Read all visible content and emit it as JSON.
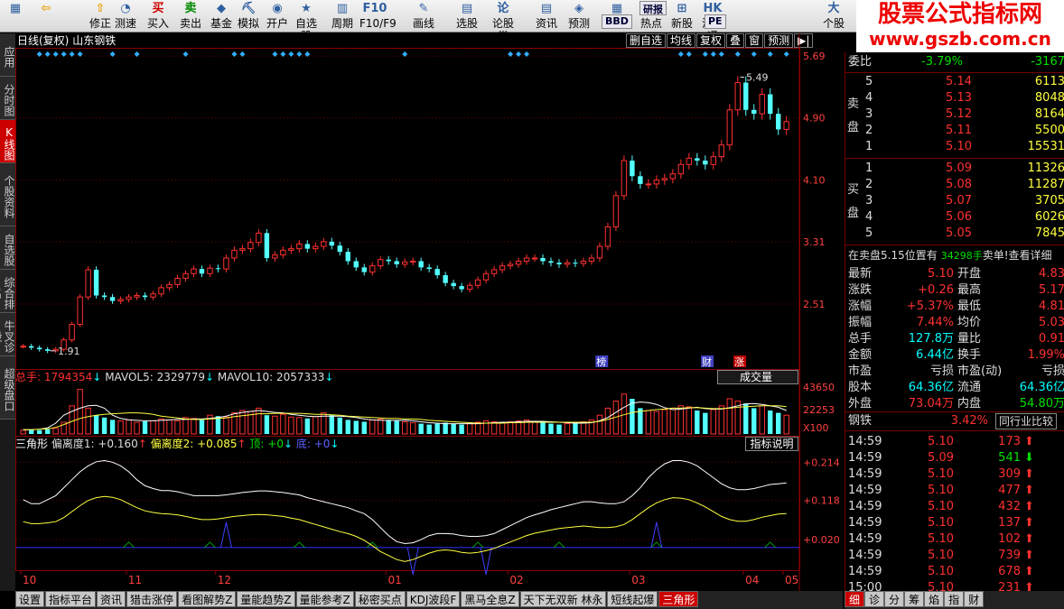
{
  "toolbar": {
    "buttons": [
      {
        "label": "",
        "icon": "app-icon"
      },
      {
        "label": "",
        "icon": "back-icon"
      },
      {
        "label": "修正",
        "icon": "up-down-icon"
      },
      {
        "label": "测速",
        "icon": "clock-icon"
      },
      {
        "label": "买入",
        "icon": "buy-icon",
        "glyph": "买"
      },
      {
        "label": "卖出",
        "icon": "sell-icon",
        "glyph": "卖"
      },
      {
        "label": "基金",
        "icon": "fund-icon"
      },
      {
        "label": "模拟",
        "icon": "simulate-icon"
      },
      {
        "label": "开户",
        "icon": "account-icon"
      },
      {
        "label": "自选股",
        "icon": "star-icon"
      },
      {
        "label": "周期",
        "icon": "period-icon"
      },
      {
        "label": "F10/F9",
        "icon": "f10-icon"
      },
      {
        "label": "画线",
        "icon": "draw-icon"
      },
      {
        "label": "选股",
        "icon": "select-icon"
      },
      {
        "label": "论股堂",
        "icon": "forum-icon"
      },
      {
        "label": "资讯",
        "icon": "news-icon"
      },
      {
        "label": "预测",
        "icon": "forecast-icon"
      },
      {
        "label": "数据",
        "icon": "data-icon"
      },
      {
        "label": "热点",
        "icon": "hot-icon"
      },
      {
        "label": "新股",
        "icon": "new-stock-icon"
      },
      {
        "label": "沪港通",
        "icon": "hk-icon"
      },
      {
        "label": "个股",
        "icon": "stock-icon"
      }
    ],
    "small_buttons": [
      "BBD",
      "PE",
      "研报"
    ]
  },
  "watermark": {
    "line1": "股票公式指标网",
    "line2": "www.gszb.com.cn"
  },
  "left_tabs": [
    {
      "label": "应用"
    },
    {
      "label": "分时图"
    },
    {
      "label": "K线图",
      "active": true
    },
    {
      "label": "个股资料"
    },
    {
      "label": "自选股"
    },
    {
      "label": "综合排名"
    },
    {
      "label": "牛叉诊股"
    },
    {
      "label": "超级盘口"
    }
  ],
  "chart_header": {
    "period": "日线(复权)",
    "stock_name": "山东钢铁",
    "buttons": [
      "删自选",
      "均线",
      "复权",
      "叠",
      "窗",
      "预测",
      "▶|"
    ]
  },
  "chart_data": [
    {
      "type": "candlestick",
      "title": "日线(复权) 山东钢铁",
      "y_ticks": [
        5.69,
        4.9,
        4.1,
        3.31,
        2.51
      ],
      "ylim": [
        1.7,
        5.75
      ],
      "x_ticks": [
        "10",
        "11",
        "12",
        "01",
        "02",
        "03",
        "04",
        "05"
      ],
      "annotations": {
        "high": "5.49",
        "low": "1.91",
        "markers": [
          "榜",
          "财",
          "涨"
        ]
      },
      "close": [
        1.97,
        1.95,
        1.93,
        1.91,
        1.93,
        2.05,
        2.25,
        2.6,
        2.95,
        2.62,
        2.6,
        2.55,
        2.57,
        2.6,
        2.62,
        2.6,
        2.64,
        2.72,
        2.76,
        2.84,
        2.9,
        2.96,
        2.9,
        2.97,
        2.96,
        3.1,
        3.2,
        3.22,
        3.3,
        3.42,
        3.1,
        3.14,
        3.2,
        3.22,
        3.28,
        3.22,
        3.25,
        3.31,
        3.26,
        3.18,
        3.06,
        2.98,
        2.92,
        3.0,
        3.08,
        3.06,
        3.02,
        3.05,
        3.06,
        2.98,
        2.96,
        2.88,
        2.78,
        2.74,
        2.7,
        2.75,
        2.82,
        2.9,
        2.95,
        3.0,
        3.02,
        3.06,
        3.1,
        3.1,
        3.06,
        3.04,
        3.02,
        3.04,
        3.03,
        3.06,
        3.1,
        3.25,
        3.5,
        3.9,
        4.35,
        4.15,
        4.05,
        4.05,
        4.1,
        4.12,
        4.18,
        4.3,
        4.38,
        4.35,
        4.3,
        4.4,
        4.55,
        5.0,
        5.35,
        5.0,
        4.95,
        5.2,
        4.95,
        4.75,
        4.85
      ]
    },
    {
      "type": "bar",
      "title": "成交量",
      "legend": {
        "total": "总手: 1794354",
        "mavol5": "MAVOL5: 2329779",
        "mavol10": "MAVOL10: 2057333"
      },
      "y_ticks": [
        "43650",
        "22253",
        "X100"
      ],
      "volume": [
        8,
        9,
        8,
        10,
        12,
        25,
        60,
        95,
        55,
        40,
        35,
        30,
        28,
        30,
        25,
        27,
        28,
        32,
        30,
        28,
        35,
        33,
        30,
        40,
        38,
        36,
        45,
        50,
        48,
        55,
        40,
        38,
        42,
        36,
        35,
        33,
        37,
        45,
        40,
        35,
        30,
        28,
        26,
        30,
        32,
        30,
        28,
        26,
        24,
        22,
        20,
        22,
        24,
        22,
        20,
        22,
        25,
        28,
        26,
        24,
        26,
        28,
        30,
        26,
        24,
        22,
        20,
        22,
        24,
        26,
        30,
        40,
        55,
        70,
        85,
        75,
        55,
        50,
        48,
        52,
        55,
        60,
        58,
        50,
        45,
        52,
        60,
        75,
        70,
        65,
        55,
        60,
        50,
        45,
        40
      ],
      "mavol5": [
        9,
        9,
        10,
        13,
        23,
        40,
        48,
        55,
        60,
        61,
        55,
        40,
        33,
        30,
        29,
        28,
        28,
        29,
        30,
        31,
        31,
        32,
        32,
        33,
        35,
        38,
        43,
        46,
        48,
        50,
        48,
        46,
        45,
        42,
        40,
        38,
        37,
        38,
        38,
        38,
        37,
        35,
        32,
        30,
        29,
        29,
        29,
        29,
        28,
        26,
        24,
        23,
        22,
        22,
        22,
        22,
        22,
        23,
        24,
        25,
        25,
        26,
        27,
        27,
        27,
        26,
        25,
        24,
        23,
        23,
        24,
        28,
        35,
        46,
        57,
        66,
        68,
        67,
        63,
        56,
        52,
        53,
        55,
        57,
        54,
        53,
        53,
        56,
        60,
        64,
        65,
        63,
        60,
        57,
        50
      ],
      "mavol10": [
        9,
        9,
        10,
        11,
        14,
        20,
        27,
        33,
        37,
        40,
        42,
        43,
        44,
        45,
        45,
        44,
        42,
        38,
        36,
        34,
        32,
        31,
        31,
        32,
        33,
        34,
        37,
        39,
        41,
        43,
        43,
        44,
        44,
        44,
        44,
        43,
        42,
        42,
        41,
        40,
        38,
        37,
        36,
        35,
        34,
        33,
        33,
        32,
        32,
        31,
        29,
        28,
        27,
        26,
        25,
        24,
        23,
        23,
        23,
        23,
        24,
        24,
        25,
        25,
        25,
        25,
        25,
        25,
        25,
        25,
        25,
        27,
        31,
        36,
        41,
        46,
        48,
        50,
        52,
        53,
        55,
        55,
        56,
        56,
        55,
        54,
        54,
        55,
        57,
        58,
        59,
        60,
        60,
        60,
        58
      ]
    },
    {
      "type": "line",
      "title": "三角形",
      "legend": {
        "name": "三角形",
        "dev1": "偏离度1: +0.160",
        "dev2": "偏离度2: +0.085",
        "top": "顶: +0",
        "bottom": "底: +0"
      },
      "y_ticks": [
        "+0.214",
        "+0.118",
        "+0.020"
      ],
      "ylim": [
        -0.05,
        0.235
      ],
      "series": [
        {
          "name": "偏离度1",
          "values": [
            0.12,
            0.11,
            0.11,
            0.12,
            0.13,
            0.15,
            0.17,
            0.19,
            0.205,
            0.215,
            0.218,
            0.214,
            0.205,
            0.19,
            0.17,
            0.155,
            0.148,
            0.143,
            0.143,
            0.14,
            0.135,
            0.13,
            0.13,
            0.13,
            0.13,
            0.132,
            0.135,
            0.138,
            0.14,
            0.142,
            0.142,
            0.14,
            0.138,
            0.135,
            0.132,
            0.125,
            0.12,
            0.115,
            0.11,
            0.105,
            0.1,
            0.092,
            0.085,
            0.07,
            0.05,
            0.03,
            0.015,
            0.01,
            0.012,
            0.02,
            0.03,
            0.035,
            0.035,
            0.034,
            0.03,
            0.028,
            0.028,
            0.03,
            0.035,
            0.045,
            0.055,
            0.065,
            0.075,
            0.082,
            0.088,
            0.095,
            0.1,
            0.105,
            0.11,
            0.115,
            0.115,
            0.112,
            0.11,
            0.11,
            0.115,
            0.13,
            0.15,
            0.175,
            0.195,
            0.21,
            0.218,
            0.218,
            0.214,
            0.205,
            0.19,
            0.175,
            0.16,
            0.15,
            0.145,
            0.145,
            0.148,
            0.153,
            0.158,
            0.16,
            0.162
          ]
        },
        {
          "name": "偏离度2",
          "values": [
            0.065,
            0.06,
            0.06,
            0.062,
            0.065,
            0.075,
            0.09,
            0.105,
            0.118,
            0.125,
            0.128,
            0.126,
            0.12,
            0.11,
            0.1,
            0.092,
            0.088,
            0.085,
            0.084,
            0.082,
            0.078,
            0.074,
            0.07,
            0.07,
            0.072,
            0.075,
            0.078,
            0.08,
            0.082,
            0.083,
            0.082,
            0.08,
            0.078,
            0.074,
            0.07,
            0.064,
            0.058,
            0.052,
            0.046,
            0.04,
            0.035,
            0.028,
            0.018,
            0.005,
            -0.01,
            -0.02,
            -0.03,
            -0.035,
            -0.03,
            -0.022,
            -0.014,
            -0.008,
            -0.006,
            -0.008,
            -0.012,
            -0.014,
            -0.012,
            -0.008,
            -0.002,
            0.006,
            0.014,
            0.022,
            0.03,
            0.036,
            0.04,
            0.044,
            0.048,
            0.05,
            0.052,
            0.054,
            0.052,
            0.05,
            0.05,
            0.052,
            0.058,
            0.07,
            0.085,
            0.1,
            0.112,
            0.12,
            0.125,
            0.124,
            0.12,
            0.112,
            0.102,
            0.09,
            0.078,
            0.07,
            0.066,
            0.066,
            0.07,
            0.076,
            0.08,
            0.084,
            0.085
          ]
        },
        {
          "name": "顶",
          "values": [
            0,
            0,
            0,
            0,
            0,
            0,
            0,
            0,
            0,
            0,
            0,
            0,
            0,
            0,
            0,
            0,
            0,
            0,
            0,
            0,
            0,
            0,
            0,
            0,
            0,
            0,
            0,
            0,
            0,
            0,
            0,
            0,
            0,
            0,
            0,
            0,
            0,
            0,
            0,
            0,
            0,
            0,
            0,
            0,
            0,
            0,
            0,
            0,
            0,
            0,
            0,
            0,
            0,
            0,
            0,
            0,
            0,
            0,
            0,
            0,
            0,
            0,
            0,
            0,
            0,
            0,
            0,
            0,
            0,
            0,
            0,
            0,
            0,
            0,
            0,
            0,
            0,
            0,
            0,
            0,
            0,
            0,
            0,
            0,
            0,
            0,
            0,
            0,
            0,
            0,
            0,
            0,
            0,
            0,
            0
          ]
        },
        {
          "name": "底",
          "values": [
            0,
            0,
            0,
            0,
            0,
            0,
            0,
            0,
            0,
            0,
            0,
            0,
            0,
            0,
            0,
            0,
            0,
            0,
            0,
            0,
            0,
            0,
            0,
            0,
            0,
            0,
            0,
            0,
            0,
            0,
            0,
            0,
            0,
            0,
            0,
            0,
            0,
            0,
            0,
            0,
            0,
            0,
            0,
            0,
            0,
            0,
            0,
            0,
            0,
            0,
            0,
            0,
            0,
            0,
            0,
            0,
            0,
            0,
            0,
            0,
            0,
            0,
            0,
            0,
            0,
            0,
            0,
            0,
            0,
            0,
            0,
            0,
            0,
            0,
            0,
            0,
            0,
            0,
            0,
            0,
            0,
            0,
            0,
            0,
            0,
            0,
            0,
            0,
            0,
            0,
            0,
            0,
            0,
            0,
            0
          ]
        }
      ]
    }
  ],
  "volume_dropdown": "成交量",
  "indicator_help": "指标说明",
  "bottom_tabs": [
    "设置",
    "指标平台",
    "资讯",
    "猎击涨停",
    "看图解势Z",
    "量能趋势Z",
    "量能参考Z",
    "秘密买点",
    "KDJ波段F",
    "黑马全息Z",
    "天下无双新 林永",
    "短线起爆",
    "三角形"
  ],
  "active_bottom_tab": "三角形",
  "right_panel": {
    "weibi": {
      "label": "委比",
      "pct": "-3.79%",
      "diff": "-3167"
    },
    "sell_label": "卖盘",
    "buy_label": "买盘",
    "sells": [
      {
        "lvl": "5",
        "price": "5.14",
        "vol": "6113"
      },
      {
        "lvl": "4",
        "price": "5.13",
        "vol": "8048"
      },
      {
        "lvl": "3",
        "price": "5.12",
        "vol": "8164"
      },
      {
        "lvl": "2",
        "price": "5.11",
        "vol": "5500"
      },
      {
        "lvl": "1",
        "price": "5.10",
        "vol": "15531"
      }
    ],
    "buys": [
      {
        "lvl": "1",
        "price": "5.09",
        "vol": "11326"
      },
      {
        "lvl": "2",
        "price": "5.08",
        "vol": "11287"
      },
      {
        "lvl": "3",
        "price": "5.07",
        "vol": "3705"
      },
      {
        "lvl": "4",
        "price": "5.06",
        "vol": "6026"
      },
      {
        "lvl": "5",
        "price": "5.05",
        "vol": "7845"
      }
    ],
    "note": {
      "a": "在卖盘5.15位置有",
      "b": "34298手",
      "c": "卖单!",
      "d": "查看详细"
    },
    "stats": [
      {
        "l1": "最新",
        "v1": "5.10",
        "l2": "开盘",
        "v2": "4.83"
      },
      {
        "l1": "涨跌",
        "v1": "+0.26",
        "l2": "最高",
        "v2": "5.17"
      },
      {
        "l1": "涨幅",
        "v1": "+5.37%",
        "l2": "最低",
        "v2": "4.81"
      },
      {
        "l1": "振幅",
        "v1": "7.44%",
        "l2": "均价",
        "v2": "5.03"
      },
      {
        "l1": "总手",
        "v1": "127.8万",
        "l2": "量比",
        "v2": "0.91"
      },
      {
        "l1": "金额",
        "v1": "6.44亿",
        "l2": "换手",
        "v2": "1.99%"
      },
      {
        "l1": "市盈",
        "v1": "亏损",
        "l2": "市盈(动)",
        "v2": "亏损"
      },
      {
        "l1": "股本",
        "v1": "64.36亿",
        "l2": "流通",
        "v2": "64.36亿"
      },
      {
        "l1": "外盘",
        "v1": "73.04万",
        "l2": "内盘",
        "v2": "54.80万"
      }
    ],
    "industry": {
      "name": "钢铁",
      "pct": "3.42%",
      "button": "同行业比较"
    },
    "ticks": [
      {
        "t": "14:59",
        "p": "5.10",
        "v": "173",
        "d": "up"
      },
      {
        "t": "14:59",
        "p": "5.09",
        "v": "541",
        "d": "down"
      },
      {
        "t": "14:59",
        "p": "5.10",
        "v": "309",
        "d": "up"
      },
      {
        "t": "14:59",
        "p": "5.10",
        "v": "477",
        "d": "up"
      },
      {
        "t": "14:59",
        "p": "5.10",
        "v": "432",
        "d": "up"
      },
      {
        "t": "14:59",
        "p": "5.10",
        "v": "137",
        "d": "up"
      },
      {
        "t": "14:59",
        "p": "5.10",
        "v": "102",
        "d": "up"
      },
      {
        "t": "14:59",
        "p": "5.10",
        "v": "739",
        "d": "up"
      },
      {
        "t": "14:59",
        "p": "5.10",
        "v": "678",
        "d": "up"
      },
      {
        "t": "15:00",
        "p": "5.10",
        "v": "231",
        "d": "up"
      }
    ],
    "bottom_tabs": [
      "细",
      "诊",
      "分",
      "筹",
      "焰",
      "指",
      "财"
    ]
  }
}
